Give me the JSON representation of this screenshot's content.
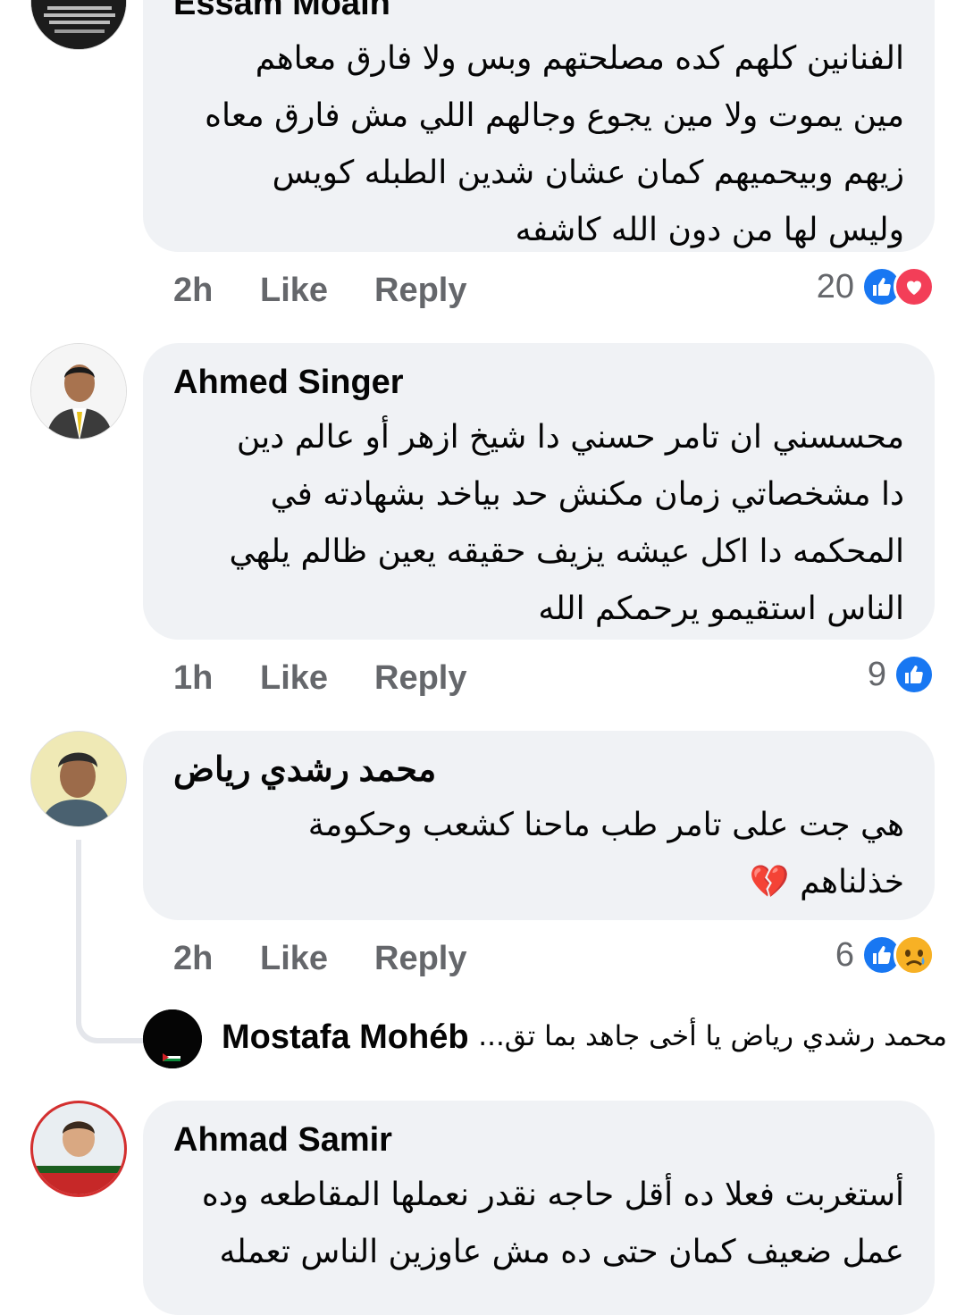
{
  "comments": [
    {
      "author": "Essam Moàin",
      "lines": [
        "الفنانين كلهم كده مصلحتهم وبس ولا فارق معاهم",
        "مين يموت ولا مين يجوع وجالهم اللي مش فارق معاه",
        "زيهم وبيحميهم كمان عشان شدين الطبله كويس",
        "وليس لها من دون الله كاشفه"
      ],
      "time": "2h",
      "like": "Like",
      "reply": "Reply",
      "reaction_count": "20",
      "reactions": [
        "like-icon",
        "love-icon"
      ]
    },
    {
      "author": "Ahmed Singer",
      "lines": [
        "محسسني ان تامر حسني دا شيخ ازهر أو عالم دين",
        "دا مشخصاتي زمان مكنش حد بياخد بشهادته في",
        "المحكمه دا اكل عيشه يزيف حقيقه يعين ظالم يلهي",
        "الناس استقيمو يرحمكم الله"
      ],
      "time": "1h",
      "like": "Like",
      "reply": "Reply",
      "reaction_count": "9",
      "reactions": [
        "like-icon"
      ]
    },
    {
      "author": "محمد رشدي رياض",
      "lines": [
        "هي جت على تامر طب ماحنا كشعب وحكومة",
        "خذلناهم 💔"
      ],
      "time": "2h",
      "like": "Like",
      "reply": "Reply",
      "reaction_count": "6",
      "reactions": [
        "like-icon",
        "sad-icon"
      ]
    },
    {
      "author": "Ahmad Samir",
      "lines": [
        "أستغربت فعلا ده أقل حاجه نقدر نعملها المقاطعه وده",
        "عمل ضعيف كمان حتى ده مش عاوزين الناس تعمله"
      ]
    }
  ],
  "reply_preview": {
    "author": "Mostafa Mohéb",
    "snippet": "محمد رشدي رياض يا أخى جاهد بما تق..."
  },
  "colors": {
    "bubble": "#f0f2f5",
    "meta": "#65676b",
    "like": "#1877f2",
    "love": "#f33e58",
    "sad": "#f7b125"
  }
}
